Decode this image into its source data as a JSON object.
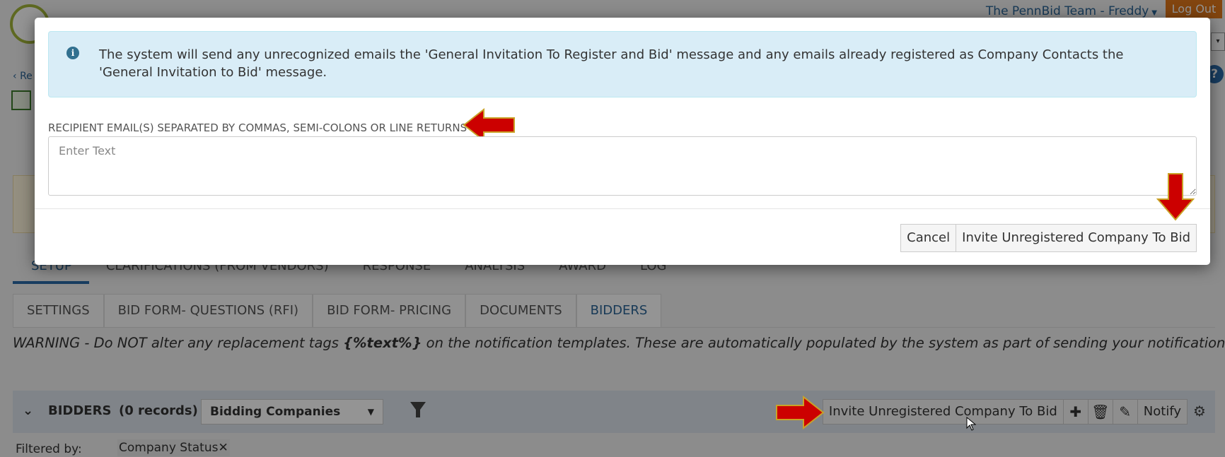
{
  "header": {
    "user_menu": "The PennBid Team - Freddy",
    "logout": "Log Out",
    "back_link": "Re",
    "help": "?"
  },
  "main_tabs": [
    {
      "label": "SETUP",
      "active": true
    },
    {
      "label": "CLARIFICATIONS (FROM VENDORS)",
      "active": false
    },
    {
      "label": "RESPONSE",
      "active": false
    },
    {
      "label": "ANALYSIS",
      "active": false
    },
    {
      "label": "AWARD",
      "active": false
    },
    {
      "label": "LOG",
      "active": false
    }
  ],
  "sub_tabs": [
    {
      "label": "SETTINGS",
      "active": false
    },
    {
      "label": "BID FORM- QUESTIONS (RFI)",
      "active": false
    },
    {
      "label": "BID FORM- PRICING",
      "active": false
    },
    {
      "label": "DOCUMENTS",
      "active": false
    },
    {
      "label": "BIDDERS",
      "active": true
    }
  ],
  "warning": {
    "before": "WARNING - Do NOT alter any replacement tags ",
    "tag": "{%text%}",
    "after": " on the notification templates. These are automatically populated by the system as part of sending your notification."
  },
  "bidders_bar": {
    "title": "BIDDERS",
    "count": "(0 records)",
    "select_value": "Bidding Companies",
    "invite_button": "Invite Unregistered Company To Bid",
    "notify_button": "Notify"
  },
  "filter": {
    "label": "Filtered by:",
    "chip": "Company Status"
  },
  "modal": {
    "info_text": "The system will send any unrecognized emails the 'General Invitation To Register and Bid' message and any emails already registered as Company Contacts the 'General Invitation to Bid' message.",
    "field_label": "RECIPIENT EMAIL(S) SEPARATED BY COMMAS, SEMI-COLONS OR LINE RETURNS",
    "placeholder": "Enter Text",
    "value": "",
    "cancel": "Cancel",
    "submit": "Invite Unregistered Company To Bid"
  },
  "colors": {
    "arrow_fill": "#cc0000",
    "arrow_outline": "#c9a227",
    "accent": "#2a6aa8",
    "info_bg": "#d9edf7"
  }
}
